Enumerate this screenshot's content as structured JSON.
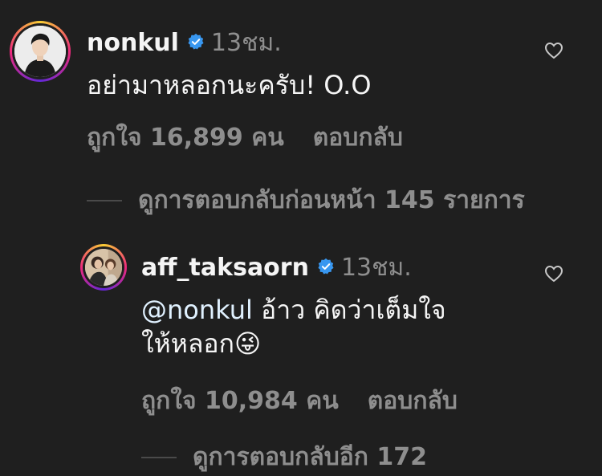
{
  "comments": {
    "top": {
      "username": "nonkul",
      "timestamp": "13ชม.",
      "text": "อย่ามาหลอกนะครับ! O.O",
      "likes": "ถูกใจ 16,899 คน",
      "reply_label": "ตอบกลับ",
      "avatar_icon": "profile-photo-man-icon",
      "verified_icon": "verified-badge-icon",
      "like_icon": "heart-outline-icon"
    },
    "view_previous_replies": "ดูการตอบกลับก่อนหน้า 145 รายการ",
    "reply": {
      "username": "aff_taksaorn",
      "timestamp": "13ชม.",
      "mention": "@nonkul",
      "text_line1": " อ้าว คิดว่าเต็มใจ",
      "text_line2": "ให้หลอก😜",
      "likes": "ถูกใจ 10,984 คน",
      "reply_label": "ตอบกลับ",
      "avatar_icon": "profile-photo-group-icon",
      "verified_icon": "verified-badge-icon",
      "like_icon": "heart-outline-icon"
    },
    "view_more_partial": "ดูการตอบกลับอีก 172"
  },
  "colors": {
    "background": "#1f1f1f",
    "secondary_text": "#8e8e8e",
    "verified_blue": "#3897f0",
    "mention": "#e0f1ff"
  }
}
